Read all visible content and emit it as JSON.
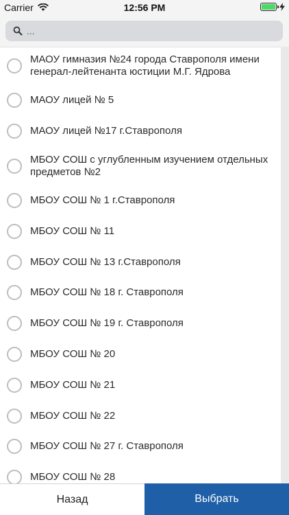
{
  "status_bar": {
    "carrier": "Carrier",
    "time": "12:56 PM",
    "battery_color": "#4cd964"
  },
  "search": {
    "placeholder": "..."
  },
  "schools": [
    "МАОУ гимназия №24 города Ставрополя имени генерал-лейтенанта юстиции М.Г. Ядрова",
    "МАОУ лицей № 5",
    "МАОУ лицей №17 г.Ставрополя",
    "МБОУ СОШ с углубленным изучением отдельных предметов №2",
    "МБОУ СОШ № 1 г.Ставрополя",
    "МБОУ СОШ № 11",
    "МБОУ СОШ № 13 г.Ставрополя",
    "МБОУ СОШ № 18 г. Ставрополя",
    "МБОУ СОШ № 19 г. Ставрополя",
    "МБОУ СОШ № 20",
    "МБОУ СОШ № 21",
    "МБОУ СОШ № 22",
    "МБОУ СОШ № 27 г. Ставрополя",
    "МБОУ СОШ № 28"
  ],
  "footer": {
    "back_label": "Назад",
    "select_label": "Выбрать",
    "accent_color": "#1f5fa7"
  }
}
